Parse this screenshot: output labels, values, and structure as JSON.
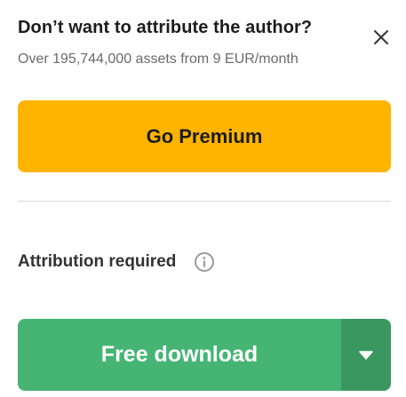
{
  "promo": {
    "headline": "Don’t want to attribute the author?",
    "subline": "Over 195,744,000 assets from 9 EUR/month",
    "close_icon": "close-icon",
    "premium_label": "Go Premium"
  },
  "attribution": {
    "label": "Attribution required",
    "info_icon": "info-icon"
  },
  "download": {
    "label": "Free download",
    "toggle_icon": "caret-down-icon"
  },
  "colors": {
    "premium": "#ffb400",
    "download": "#46b574",
    "download_toggle": "#3a9760"
  }
}
